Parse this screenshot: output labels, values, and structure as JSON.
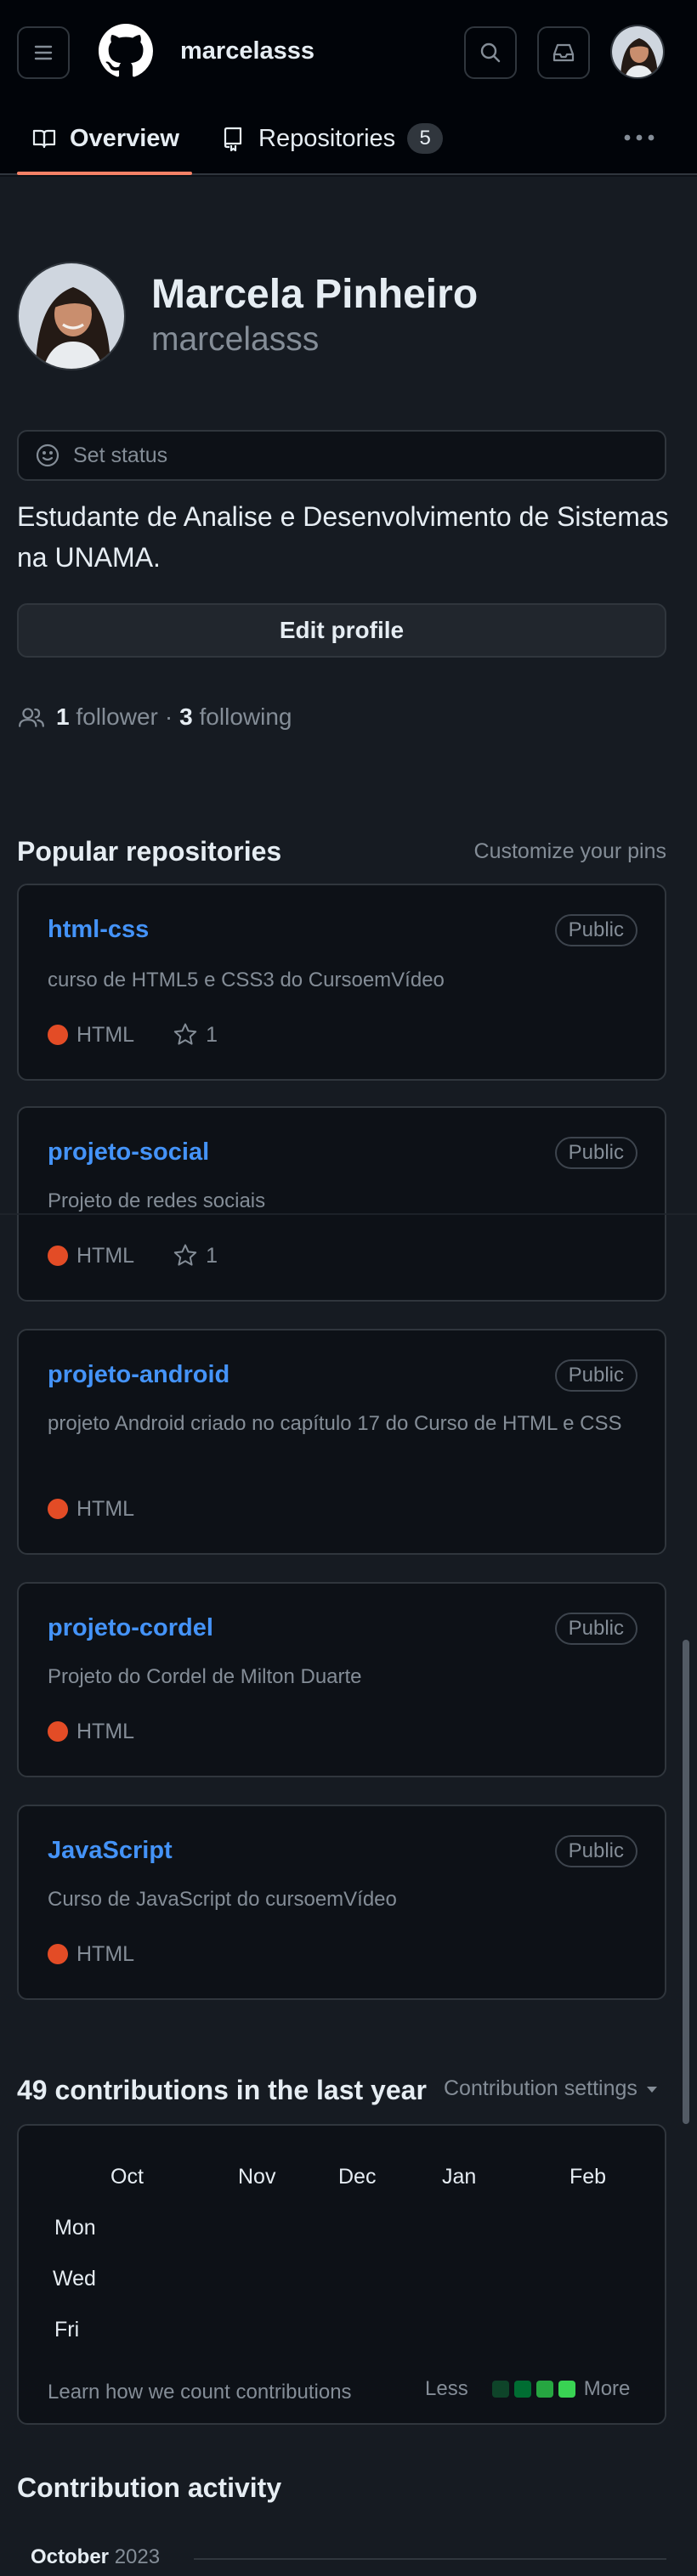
{
  "header": {
    "username": "marcelasss",
    "menu_icon": "hamburger-icon",
    "logo_icon": "github-octocat-icon",
    "search_icon": "search-icon",
    "inbox_icon": "inbox-icon"
  },
  "tabs": {
    "overview": "Overview",
    "repositories": "Repositories",
    "repositories_count": "5"
  },
  "profile": {
    "name": "Marcela Pinheiro",
    "login": "marcelasss",
    "status_placeholder": "Set status",
    "bio": "Estudante de Analise e Desenvolvimento de Sistemas na UNAMA.",
    "edit_label": "Edit profile",
    "followers_count": "1",
    "followers_label": "follower",
    "separator": "·",
    "following_count": "3",
    "following_label": "following"
  },
  "popular": {
    "title": "Popular repositories",
    "customize": "Customize your pins",
    "repos": [
      {
        "name": "html-css",
        "visibility": "Public",
        "description": "curso de HTML5 e CSS3 do CursoemVídeo",
        "language": "HTML",
        "language_color": "#e34c26",
        "stars": "1"
      },
      {
        "name": "projeto-social",
        "visibility": "Public",
        "description": "Projeto de redes sociais",
        "language": "HTML",
        "language_color": "#e34c26",
        "stars": "1"
      },
      {
        "name": "projeto-android",
        "visibility": "Public",
        "description": "projeto Android criado no capítulo 17 do Curso de HTML e CSS",
        "language": "HTML",
        "language_color": "#e34c26"
      },
      {
        "name": "projeto-cordel",
        "visibility": "Public",
        "description": "Projeto do Cordel de Milton Duarte",
        "language": "HTML",
        "language_color": "#e34c26"
      },
      {
        "name": "JavaScript",
        "visibility": "Public",
        "description": "Curso de JavaScript do cursoemVídeo",
        "language": "HTML",
        "language_color": "#e34c26"
      }
    ]
  },
  "contributions": {
    "title": "49 contributions in the last year",
    "settings_label": "Contribution settings",
    "months": [
      "Oct",
      "Nov",
      "Dec",
      "Jan",
      "Feb"
    ],
    "days": [
      "Mon",
      "Wed",
      "Fri"
    ],
    "learn_link": "Learn how we count contributions",
    "legend_less": "Less",
    "legend_more": "More",
    "legend_colors": [
      "#0e4429",
      "#006d32",
      "#26a641",
      "#39d353"
    ]
  },
  "activity": {
    "title": "Contribution activity",
    "month": "October",
    "year": "2023"
  },
  "colors": {
    "accent_underline": "#f78166",
    "link": "#4493f8",
    "background": "#0d1117"
  }
}
